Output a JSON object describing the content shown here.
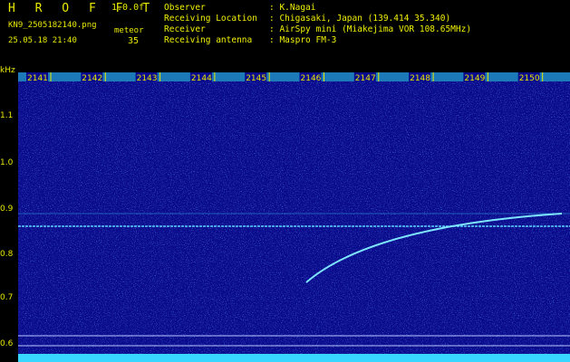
{
  "app": {
    "name": "H R O F F T",
    "version": "1.0.0f",
    "filename": "KN9_2505182140.png",
    "meteor_label": "meteor",
    "timestamp": "25.05.18 21:40",
    "meteor_count": "35"
  },
  "meta": [
    {
      "key": "Observer",
      "value": ": K.Nagai"
    },
    {
      "key": "Receiving Location",
      "value": ": Chigasaki, Japan (139.414 35.340)"
    },
    {
      "key": "Receiver",
      "value": ": AirSpy mini (Miakejima VOR 108.65MHz)"
    },
    {
      "key": "Receiving antenna",
      "value": ": Maspro FM-3"
    }
  ],
  "y_axis": {
    "unit": "kHz",
    "ticks": [
      "1.1",
      "1.0",
      "0.9",
      "0.8",
      "0.7",
      "0.6"
    ]
  },
  "time_ticks": [
    "2141",
    "2142",
    "2143",
    "2144",
    "2145",
    "2146",
    "2147",
    "2148",
    "2149",
    "2150"
  ],
  "colors": {
    "background": "#0a0a8c",
    "noise": "#1b4fd6",
    "signal": "#66ddff",
    "text": "#e8e800"
  }
}
